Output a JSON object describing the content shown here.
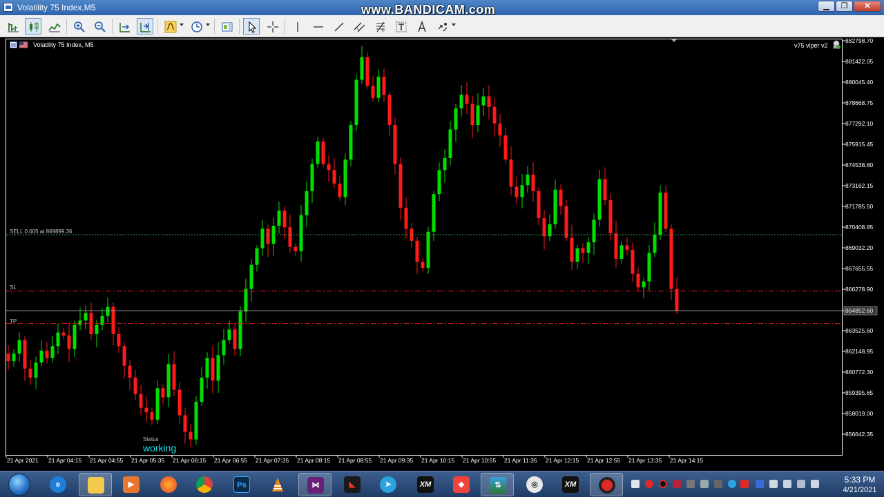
{
  "window": {
    "title": "Volatility 75 Index,M5"
  },
  "watermark": "www.BANDICAM.com",
  "window_buttons": {
    "minimize": "▁",
    "maximize": "❐",
    "close": "✕"
  },
  "toolbar": {
    "buttons": [
      "bar-chart",
      "candlestick-chart",
      "line-chart",
      "zoom-in",
      "zoom-out",
      "chart-shift",
      "auto-scroll",
      "indicators",
      "periods",
      "templates",
      "cursor",
      "crosshair",
      "vertical-line",
      "horizontal-line",
      "trend-line",
      "equidistant-channel",
      "fibonacci",
      "text",
      "text-label",
      "arrows"
    ]
  },
  "chart": {
    "symbol": "Volatility 75 Index, M5",
    "indicator": "v75 viper v2",
    "sell_label": "SELL 0.005 at 869899.36",
    "sl_label": "SL",
    "tp_label": "TP",
    "status_label": "Status",
    "status_value": "working",
    "current_price": "864852.60",
    "colors": {
      "bull": "#00e000",
      "bear": "#ff1a1a",
      "wick_bull": "#00e000",
      "wick_bear": "#ff1a1a",
      "sell_line": "#3aa85a",
      "sl_line": "#e02020",
      "tp_line": "#e02020"
    }
  },
  "chart_data": {
    "type": "candlestick",
    "y_axis_labels": [
      "882798.70",
      "881422.05",
      "880045.40",
      "878668.75",
      "877292.10",
      "875915.45",
      "874538.80",
      "873162.15",
      "871785.50",
      "870408.85",
      "869032.20",
      "867655.55",
      "866278.90",
      "864852.60",
      "863525.60",
      "862148.95",
      "860772.30",
      "859395.65",
      "858019.00",
      "856642.35"
    ],
    "x_axis_labels": [
      "21 Apr 2021",
      "21 Apr 04:15",
      "21 Apr 04:55",
      "21 Apr 05:35",
      "21 Apr 06:15",
      "21 Apr 06:55",
      "21 Apr 07:35",
      "21 Apr 08:15",
      "21 Apr 08:55",
      "21 Apr 09:35",
      "21 Apr 10:15",
      "21 Apr 10:55",
      "21 Apr 11:35",
      "21 Apr 12:15",
      "21 Apr 12:55",
      "21 Apr 13:35",
      "21 Apr 14:15"
    ],
    "levels": {
      "sell": 869899.36,
      "sl": 866150,
      "tp": 864000,
      "current": 864852.6
    },
    "ylim": [
      855900,
      883000
    ],
    "close_path": [
      861500,
      862000,
      862900,
      861000,
      860400,
      861400,
      862200,
      861700,
      862500,
      863400,
      863200,
      862300,
      863900,
      864200,
      864700,
      863300,
      863900,
      864500,
      865100,
      863300,
      862500,
      861200,
      860400,
      859300,
      858400,
      858100,
      857600,
      859700,
      859100,
      861300,
      859600,
      857900,
      856800,
      856300,
      858800,
      860400,
      861700,
      860200,
      861900,
      862900,
      863600,
      862300,
      864800,
      866300,
      867900,
      869000,
      870300,
      869300,
      870500,
      871500,
      870400,
      869100,
      868800,
      871200,
      872800,
      874600,
      876100,
      874600,
      874200,
      873300,
      872400,
      874900,
      877200,
      880200,
      881700,
      879800,
      879000,
      880400,
      879200,
      877200,
      874600,
      871700,
      870300,
      869500,
      868100,
      867700,
      870100,
      872600,
      874200,
      875000,
      876900,
      878300,
      879200,
      878600,
      877200,
      878500,
      879100,
      878400,
      877300,
      876500,
      874900,
      873100,
      872400,
      873200,
      873900,
      872800,
      871000,
      869800,
      870600,
      872900,
      871800,
      869700,
      868100,
      869000,
      868700,
      869400,
      870900,
      873600,
      872200,
      870000,
      868300,
      869200,
      868900,
      867300,
      866400,
      866800,
      868700,
      869900,
      872700,
      870300,
      866300,
      864850
    ]
  },
  "taskbar": {
    "apps": [
      "ie",
      "explorer",
      "media-player",
      "firefox",
      "chrome",
      "photoshop",
      "vlc",
      "visual-studio",
      "metatrader-dark",
      "telegram",
      "xm",
      "anydesk",
      "metatrader-5",
      "spin-app",
      "xm-2",
      "record-app"
    ],
    "clock_time": "5:33 PM",
    "clock_date": "4/21/2021"
  }
}
